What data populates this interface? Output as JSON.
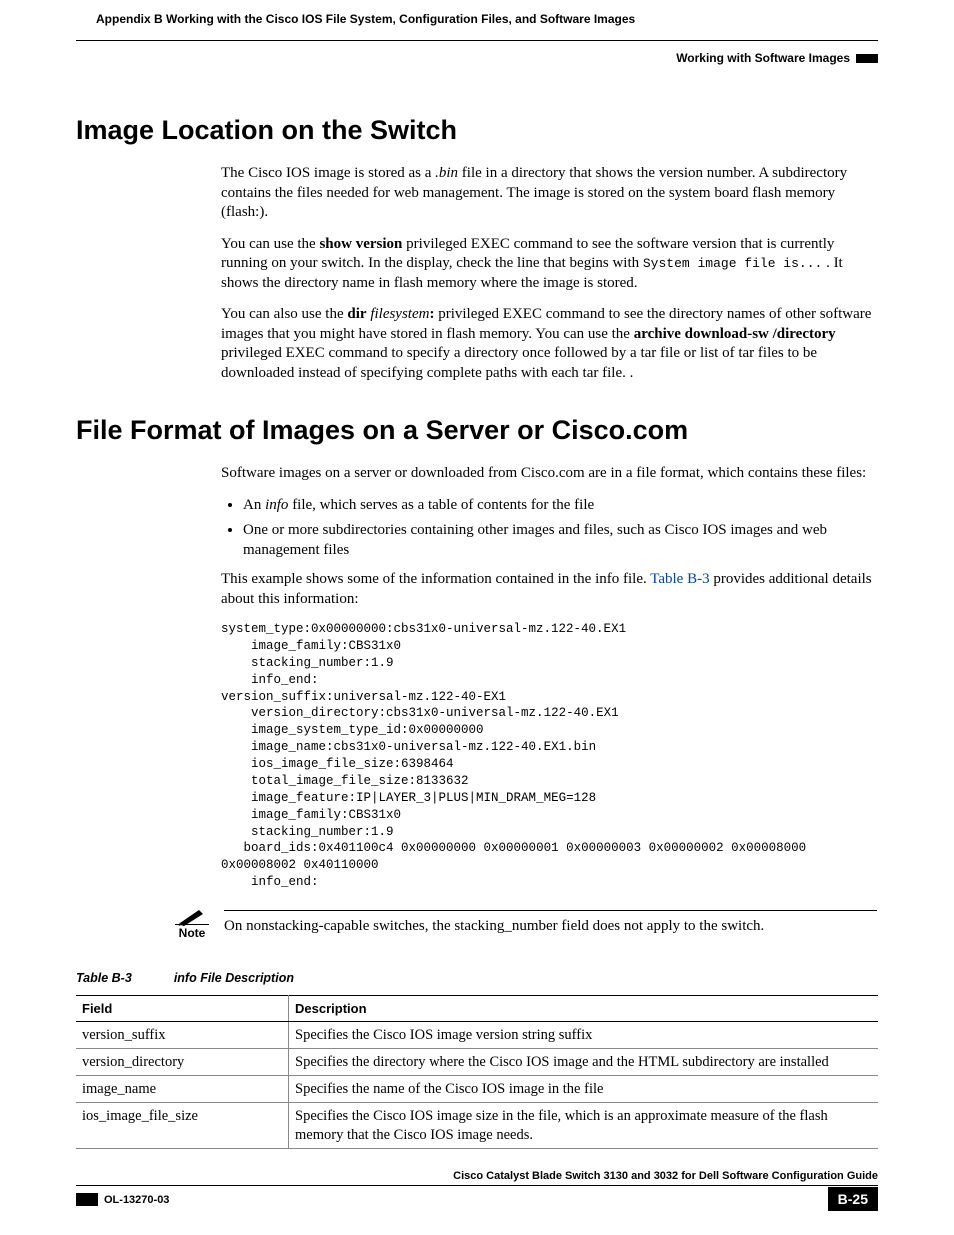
{
  "header": {
    "appendix": "Appendix B      Working with the Cisco IOS File System, Configuration Files, and Software Images",
    "section": "Working with Software Images"
  },
  "heading1": "Image Location on the Switch",
  "para1_a": "The Cisco IOS image is stored as a ",
  "para1_b": ".bin",
  "para1_c": " file in a directory that shows the version number. A subdirectory contains the files needed for web management. The image is stored on the system board flash memory (flash:).",
  "para2_a": "You can use the ",
  "para2_b": "show version",
  "para2_c": " privileged EXEC command to see the software version that is currently running on your switch. In the display, check the line that begins with ",
  "para2_d": "System image file is...",
  "para2_e": " . It shows the directory name in flash memory where the image is stored.",
  "para3_a": "You can also use the ",
  "para3_b": "dir",
  "para3_c": "filesystem",
  "para3_d": ":",
  "para3_e": " privileged EXEC command to see the directory names of other software images that you might have stored in flash memory. You can use the ",
  "para3_f": "archive download-sw /directory",
  "para3_g": " privileged EXEC command to specify a directory once followed by a tar file or list of tar files to be downloaded instead of specifying complete paths with each tar file. .",
  "heading2": "File Format of Images on a Server or Cisco.com",
  "para4": "Software images on a server or downloaded from Cisco.com are in a file format, which contains these files:",
  "bullets": {
    "b1_a": "An ",
    "b1_b": "info",
    "b1_c": " file, which serves as a table of contents for the file",
    "b2": "One or more subdirectories containing other images and files, such as Cisco IOS images and web management files"
  },
  "para5_a": "This example shows some of the information contained in the info file. ",
  "para5_b": "Table B-3",
  "para5_c": " provides additional details about this information:",
  "code": "system_type:0x00000000:cbs31x0-universal-mz.122-40.EX1\n    image_family:CBS31x0\n    stacking_number:1.9\n    info_end:\nversion_suffix:universal-mz.122-40-EX1\n    version_directory:cbs31x0-universal-mz.122-40.EX1\n    image_system_type_id:0x00000000\n    image_name:cbs31x0-universal-mz.122-40.EX1.bin\n    ios_image_file_size:6398464\n    total_image_file_size:8133632\n    image_feature:IP|LAYER_3|PLUS|MIN_DRAM_MEG=128\n    image_family:CBS31x0\n    stacking_number:1.9\n   board_ids:0x401100c4 0x00000000 0x00000001 0x00000003 0x00000002 0x00008000 0x00008002 0x40110000\n    info_end:",
  "note_label": "Note",
  "note_text": "On nonstacking-capable switches, the stacking_number field does not apply to the switch.",
  "table": {
    "caption_num": "Table B-3",
    "caption_title": "info File Description",
    "headers": [
      "Field",
      "Description"
    ],
    "rows": [
      {
        "field": "version_suffix",
        "desc": "Specifies the Cisco IOS image version string suffix"
      },
      {
        "field": "version_directory",
        "desc": "Specifies the directory where the Cisco IOS image and the HTML subdirectory are installed"
      },
      {
        "field": "image_name",
        "desc": "Specifies the name of the Cisco IOS image in the file"
      },
      {
        "field": "ios_image_file_size",
        "desc": "Specifies the Cisco IOS image size in the file, which is an approximate measure of the flash memory that the Cisco IOS image needs."
      }
    ]
  },
  "footer": {
    "guide": "Cisco Catalyst Blade Switch 3130 and 3032 for Dell Software Configuration Guide",
    "docnum": "OL-13270-03",
    "page": "B-25"
  }
}
